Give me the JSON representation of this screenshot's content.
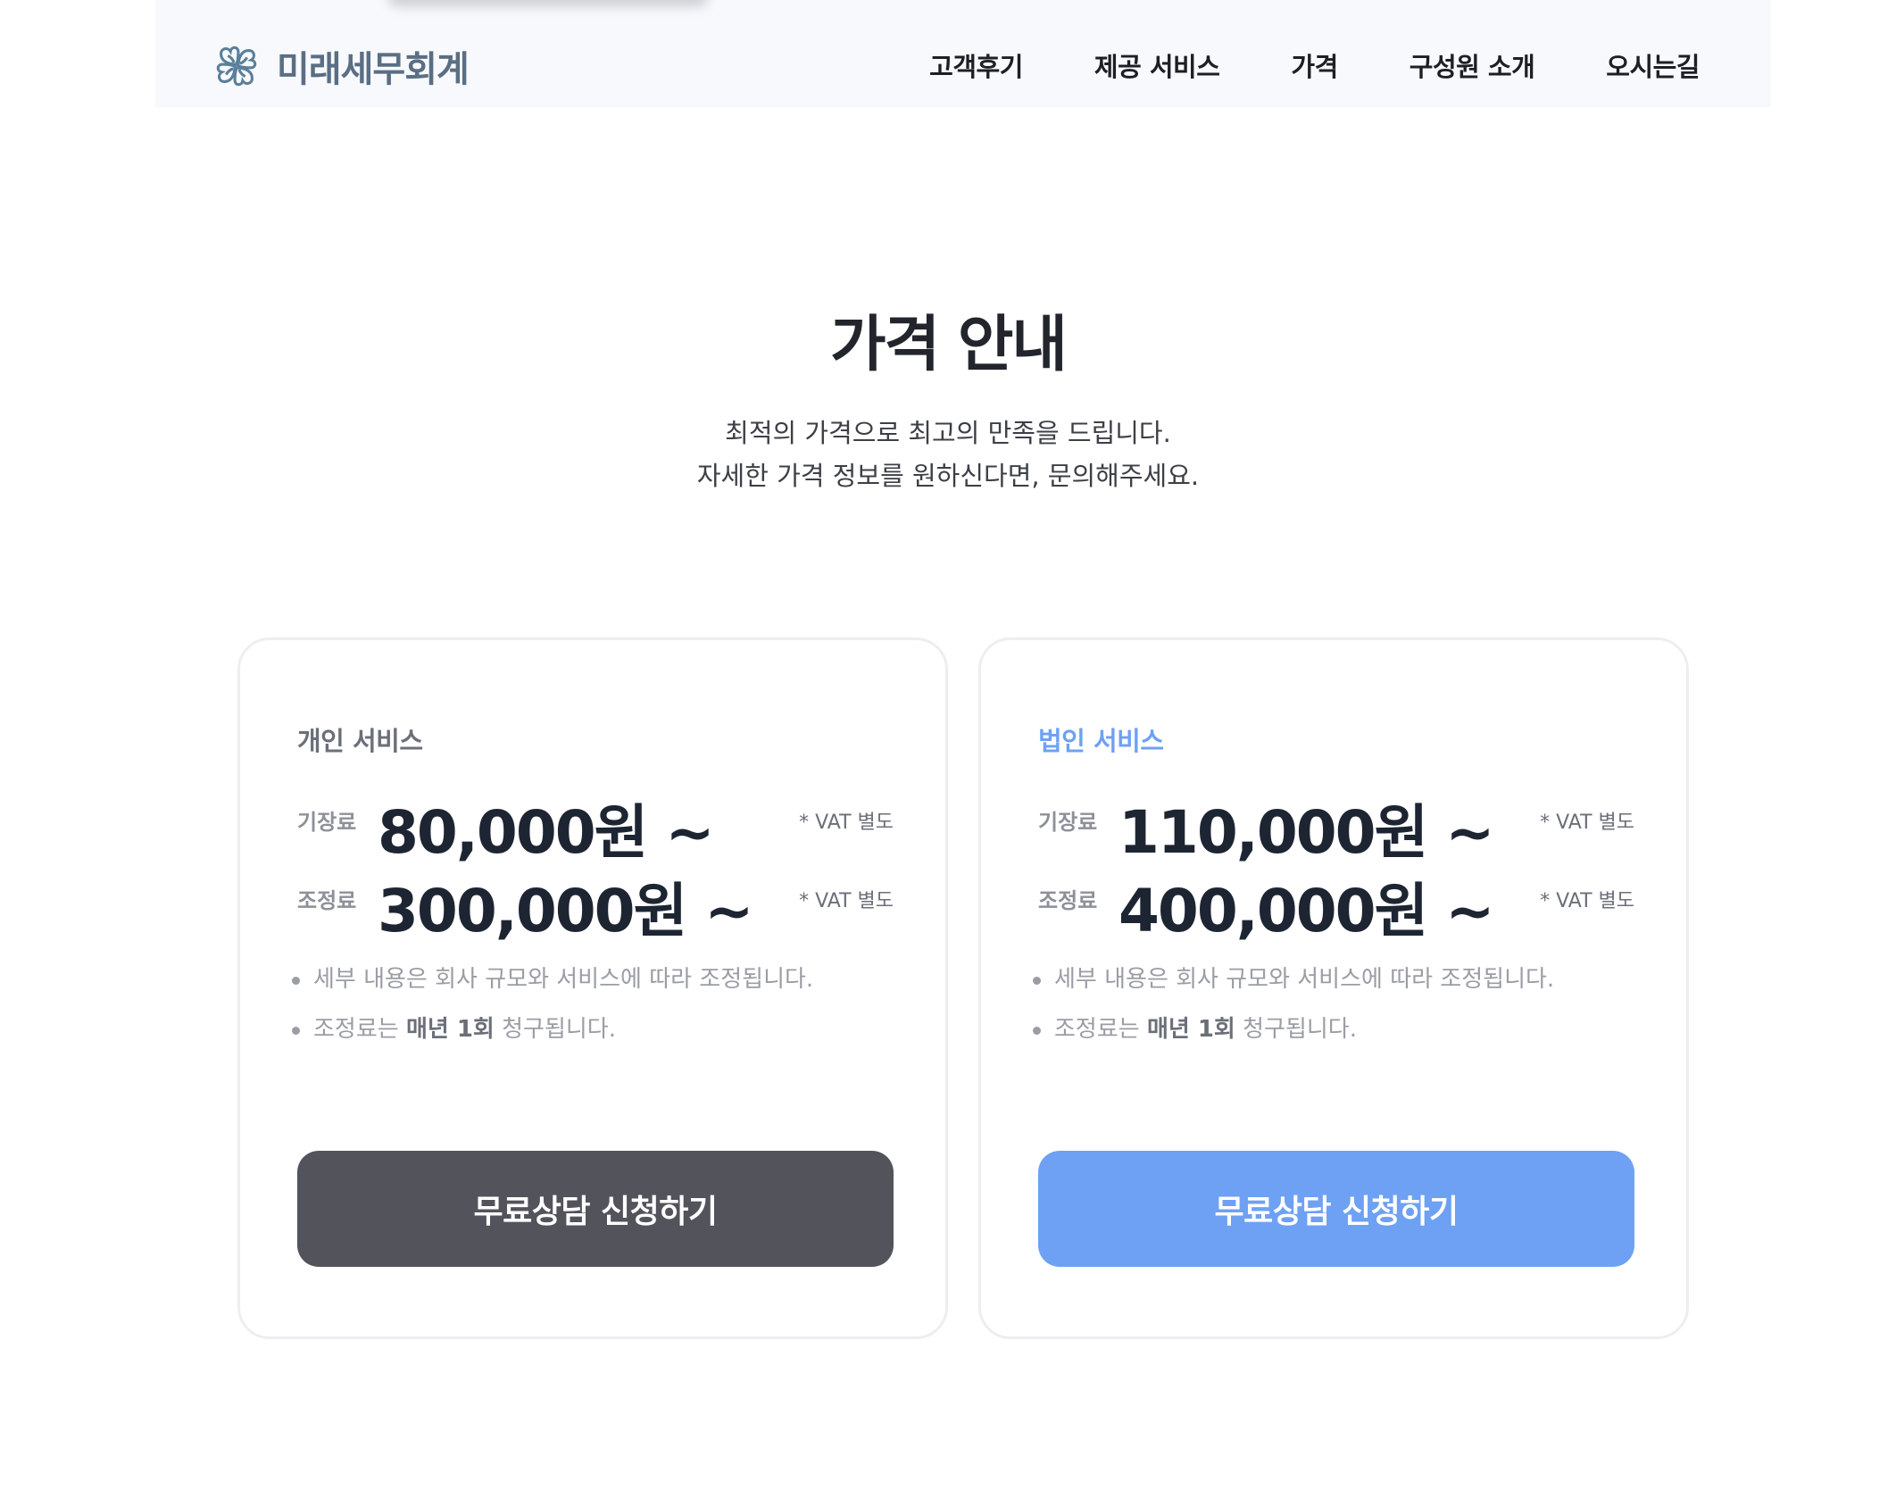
{
  "header": {
    "logo_text": "미래세무회계",
    "logo_icon": "clover-icon",
    "nav": [
      "고객후기",
      "제공 서비스",
      "가격",
      "구성원 소개",
      "오시는길"
    ]
  },
  "pricing": {
    "title": "가격 안내",
    "subtitle_lines": [
      "최적의 가격으로 최고의 만족을 드립니다.",
      "자세한 가격 정보를 원하신다면, 문의해주세요."
    ],
    "colors": {
      "dark_button": "#53535b",
      "accent_blue": "#6ea1f3"
    },
    "cards": [
      {
        "heading": "개인 서비스",
        "rows": [
          {
            "label": "기장료",
            "price": "80,000원 ~",
            "vat": "* VAT 별도"
          },
          {
            "label": "조정료",
            "price": "300,000원 ~",
            "vat": "* VAT 별도"
          }
        ],
        "note1": "세부 내용은 회사 규모와 서비스에 따라 조정됩니다.",
        "note2": {
          "pre": "조정료는 ",
          "bold": "매년 1회",
          "post": " 청구됩니다."
        },
        "button_label": "무료상담 신청하기"
      },
      {
        "heading": "법인 서비스",
        "rows": [
          {
            "label": "기장료",
            "price": "110,000원 ~",
            "vat": "* VAT 별도"
          },
          {
            "label": "조정료",
            "price": "400,000원 ~",
            "vat": "* VAT 별도"
          }
        ],
        "note1": "세부 내용은 회사 규모와 서비스에 따라 조정됩니다.",
        "note2": {
          "pre": "조정료는 ",
          "bold": "매년 1회",
          "post": " 청구됩니다."
        },
        "button_label": "무료상담 신청하기"
      }
    ]
  }
}
